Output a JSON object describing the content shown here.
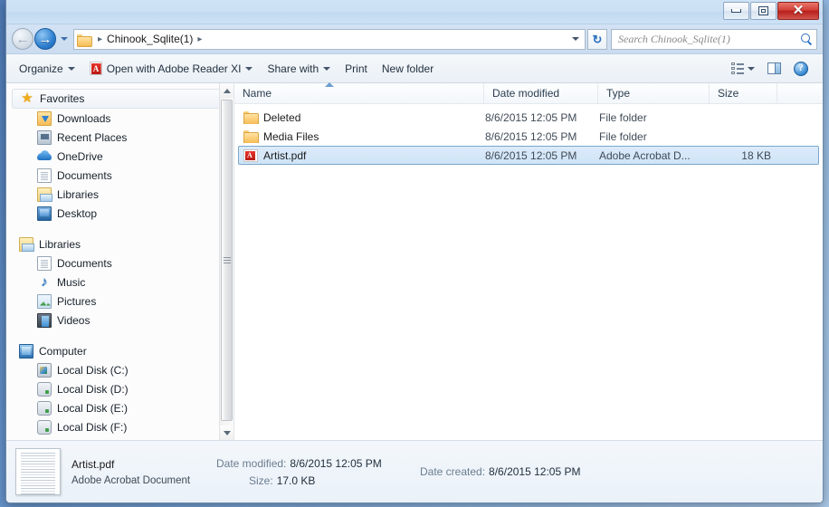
{
  "window": {
    "controls": {
      "minimize": "minimize",
      "maximize": "maximize",
      "close": "✕"
    }
  },
  "addressbar": {
    "back_label": "←",
    "forward_label": "→",
    "crumb_root": "Chinook_Sqlite(1)",
    "separator": "▸",
    "refresh_label": "↻",
    "search_placeholder": "Search Chinook_Sqlite(1)"
  },
  "toolbar": {
    "organize": "Organize",
    "open_with": "Open with Adobe Reader XI",
    "share_with": "Share with",
    "print": "Print",
    "new_folder": "New folder",
    "help_glyph": "?"
  },
  "sidebar": {
    "sections": [
      {
        "title": "Favorites",
        "icon": "star-icon",
        "items": [
          {
            "label": "Downloads",
            "icon": "downloads-icon"
          },
          {
            "label": "Recent Places",
            "icon": "recent-places-icon"
          },
          {
            "label": "OneDrive",
            "icon": "onedrive-icon"
          },
          {
            "label": "Documents",
            "icon": "document-icon"
          },
          {
            "label": "Libraries",
            "icon": "library-icon"
          },
          {
            "label": "Desktop",
            "icon": "desktop-icon"
          }
        ]
      },
      {
        "title": "Libraries",
        "icon": "library-icon",
        "items": [
          {
            "label": "Documents",
            "icon": "document-icon"
          },
          {
            "label": "Music",
            "icon": "music-icon"
          },
          {
            "label": "Pictures",
            "icon": "pictures-icon"
          },
          {
            "label": "Videos",
            "icon": "videos-icon"
          }
        ]
      },
      {
        "title": "Computer",
        "icon": "computer-icon",
        "items": [
          {
            "label": "Local Disk (C:)",
            "icon": "system-disk-icon"
          },
          {
            "label": "Local Disk (D:)",
            "icon": "disk-icon"
          },
          {
            "label": "Local Disk (E:)",
            "icon": "disk-icon"
          },
          {
            "label": "Local Disk (F:)",
            "icon": "disk-icon"
          }
        ]
      }
    ]
  },
  "filelist": {
    "columns": [
      {
        "key": "name",
        "label": "Name"
      },
      {
        "key": "date",
        "label": "Date modified"
      },
      {
        "key": "type",
        "label": "Type"
      },
      {
        "key": "size",
        "label": "Size"
      }
    ],
    "rows": [
      {
        "name": "Deleted",
        "date": "8/6/2015 12:05 PM",
        "type": "File folder",
        "size": "",
        "icon": "folder-icon",
        "selected": false
      },
      {
        "name": "Media Files",
        "date": "8/6/2015 12:05 PM",
        "type": "File folder",
        "size": "",
        "icon": "folder-icon",
        "selected": false
      },
      {
        "name": "Artist.pdf",
        "date": "8/6/2015 12:05 PM",
        "type": "Adobe Acrobat D...",
        "size": "18 KB",
        "icon": "pdf-file-icon",
        "selected": true
      }
    ]
  },
  "details": {
    "filename": "Artist.pdf",
    "filetype": "Adobe Acrobat Document",
    "date_modified_label": "Date modified:",
    "date_modified_value": "8/6/2015 12:05 PM",
    "size_label": "Size:",
    "size_value": "17.0 KB",
    "date_created_label": "Date created:",
    "date_created_value": "8/6/2015 12:05 PM"
  },
  "colors": {
    "selection": "#cfe4f7",
    "selection_border": "#7aa7cc",
    "accent": "#2a6fc0",
    "pdf_red": "#b61a14",
    "folder_yellow": "#f6bc57",
    "close_red": "#b71f1c"
  }
}
